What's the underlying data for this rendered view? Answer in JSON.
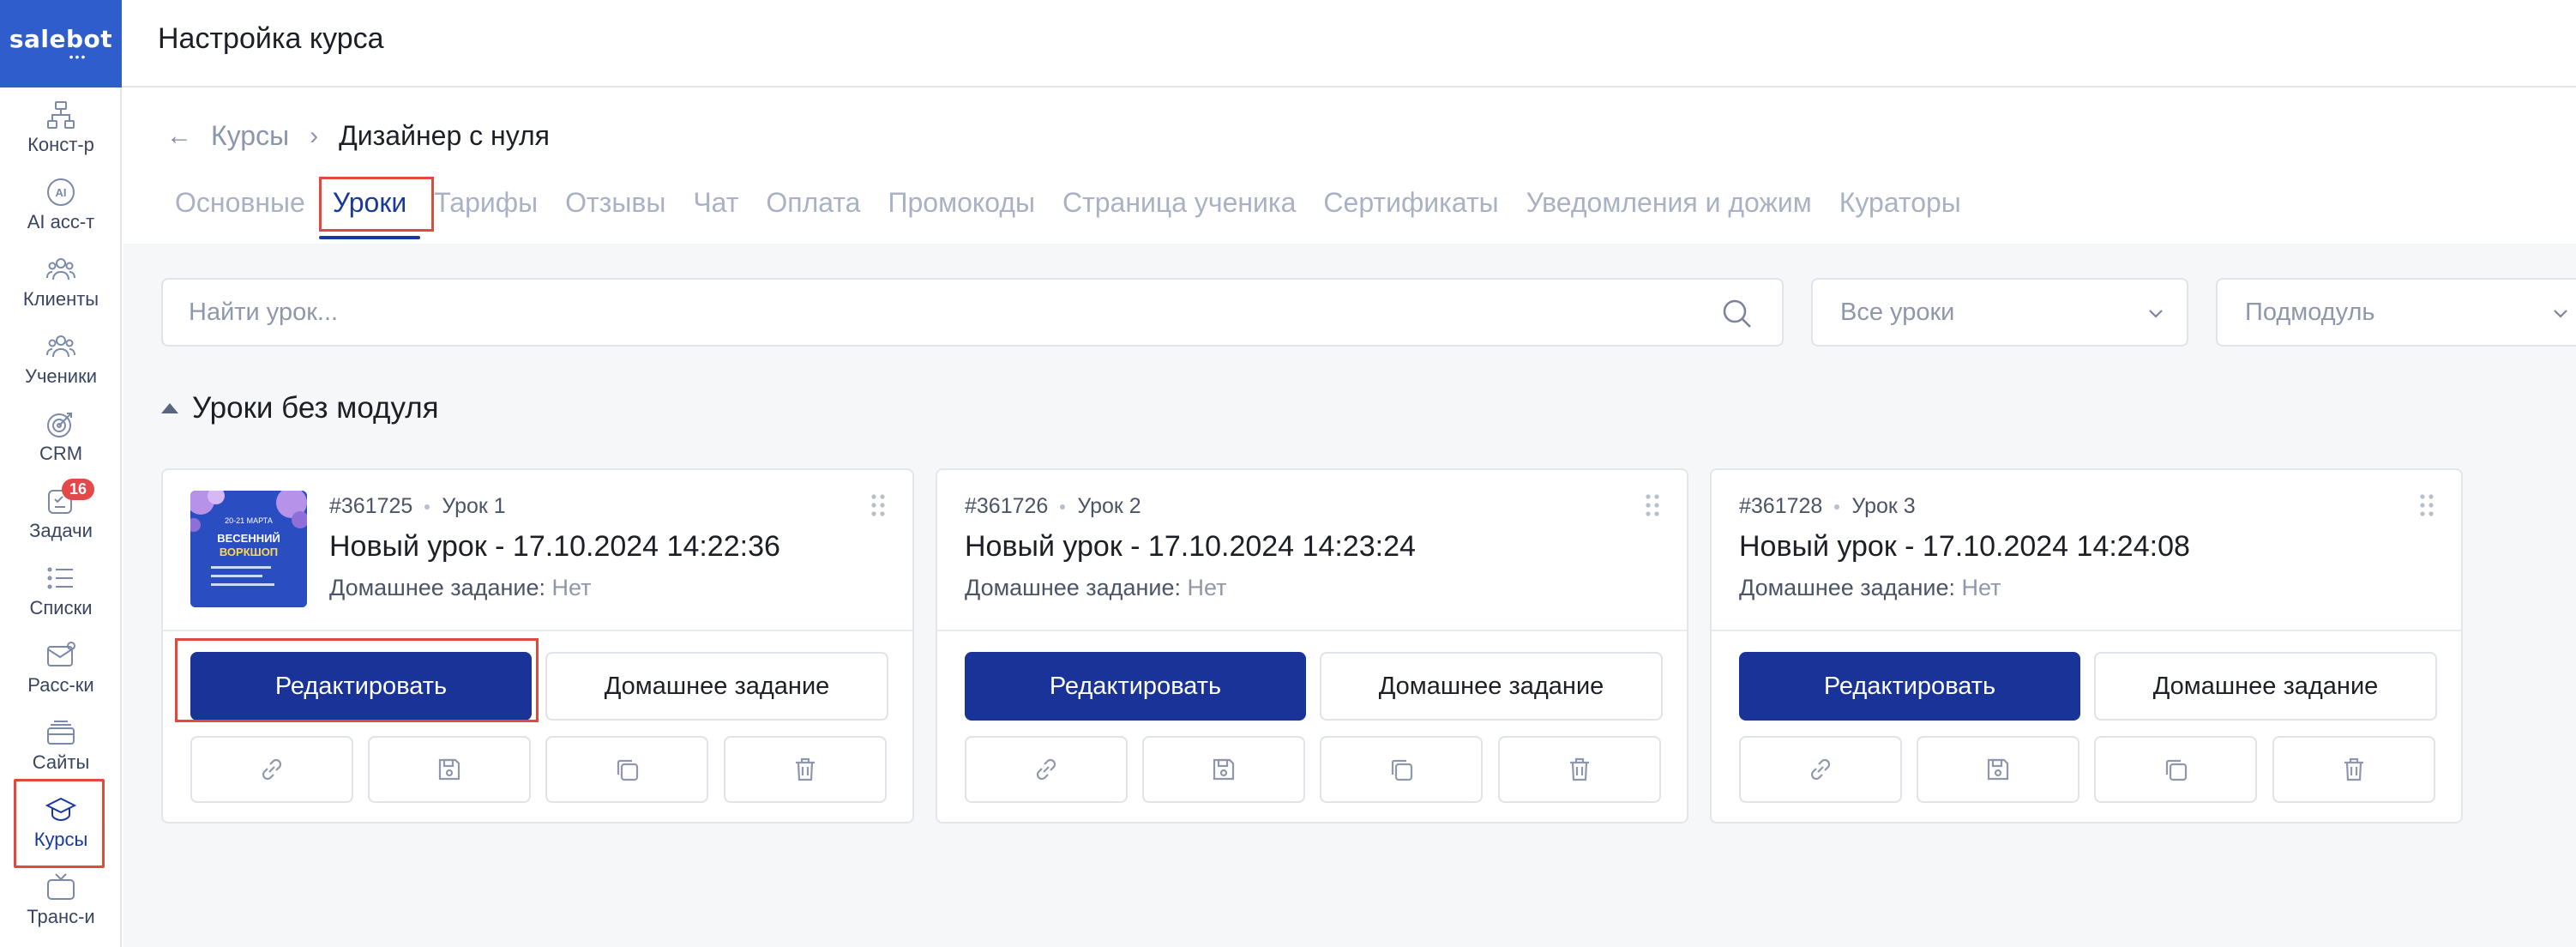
{
  "app": {
    "logo": "salebot",
    "logo_dots": "•••"
  },
  "sidebar": {
    "items": [
      {
        "label": "Конст-р",
        "icon": "sitemap-icon"
      },
      {
        "label": "AI асс-т",
        "icon": "ai-icon"
      },
      {
        "label": "Клиенты",
        "icon": "users-icon"
      },
      {
        "label": "Ученики",
        "icon": "students-icon"
      },
      {
        "label": "CRM",
        "icon": "target-icon"
      },
      {
        "label": "Задачи",
        "icon": "tasks-icon",
        "badge": "16"
      },
      {
        "label": "Списки",
        "icon": "list-icon"
      },
      {
        "label": "Расс-ки",
        "icon": "mail-icon"
      },
      {
        "label": "Сайты",
        "icon": "stack-icon"
      },
      {
        "label": "Курсы",
        "icon": "graduation-cap-icon",
        "active": true
      },
      {
        "label": "Транс-и",
        "icon": "tv-icon"
      }
    ]
  },
  "topbar": {
    "title": "Настройка курса"
  },
  "breadcrumb": {
    "parent": "Курсы",
    "current": "Дизайнер с нуля"
  },
  "tabs": [
    "Основные",
    "Уроки",
    "Тарифы",
    "Отзывы",
    "Чат",
    "Оплата",
    "Промокоды",
    "Страница ученика",
    "Сертификаты",
    "Уведомления и дожим",
    "Кураторы"
  ],
  "active_tab": "Уроки",
  "filters": {
    "search_placeholder": "Найти урок...",
    "lessons_filter": "Все уроки",
    "submodule_filter": "Подмодуль"
  },
  "section": {
    "title": "Уроки без модуля"
  },
  "lessons": [
    {
      "id": "#361725",
      "number": "Урок 1",
      "title": "Новый урок - 17.10.2024 14:22:36",
      "hw_label": "Домашнее задание:",
      "hw_value": "Нет",
      "has_thumb": true,
      "thumb_text": {
        "date": "20-21 МАРТА",
        "title1": "ВЕСЕННИЙ",
        "title2": "ВОРКШОП"
      }
    },
    {
      "id": "#361726",
      "number": "Урок 2",
      "title": "Новый урок - 17.10.2024 14:23:24",
      "hw_label": "Домашнее задание:",
      "hw_value": "Нет",
      "has_thumb": false
    },
    {
      "id": "#361728",
      "number": "Урок 3",
      "title": "Новый урок - 17.10.2024 14:24:08",
      "hw_label": "Домашнее задание:",
      "hw_value": "Нет",
      "has_thumb": false
    }
  ],
  "card_buttons": {
    "edit": "Редактировать",
    "homework": "Домашнее задание"
  },
  "colors": {
    "brand": "#2f5dcc",
    "primary_button": "#1a3399",
    "active": "#1a3a9a",
    "badge": "#e54848",
    "highlight_frame": "#e04a3c"
  }
}
